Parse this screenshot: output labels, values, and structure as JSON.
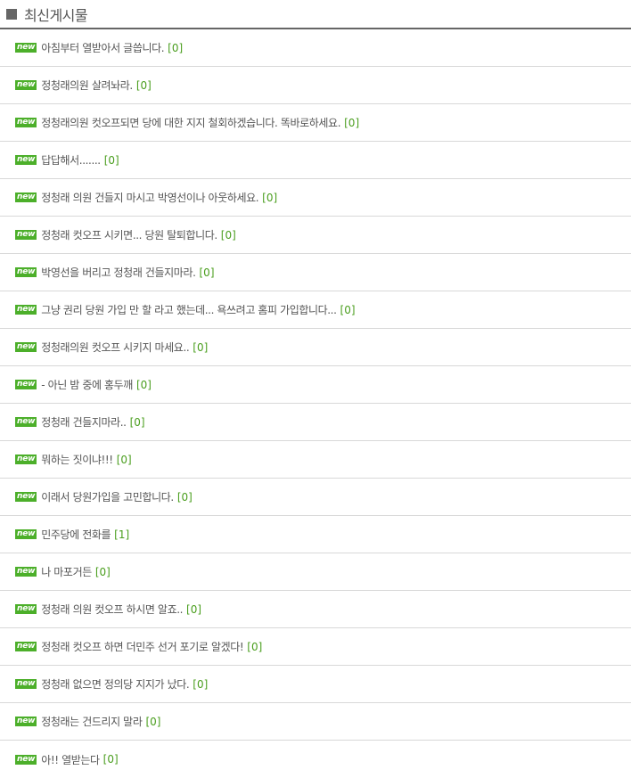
{
  "board": {
    "title": "최신게시물",
    "new_badge": "new",
    "posts": [
      {
        "title": "아침부터 열받아서 글씁니다.",
        "comments": "[0]"
      },
      {
        "title": "정청래의원 살려놔라.",
        "comments": "[0]"
      },
      {
        "title": "정청래의원 컷오프되면 당에 대한 지지 철회하겠습니다. 똑바로하세요.",
        "comments": "[0]"
      },
      {
        "title": "답답해서.......",
        "comments": "[0]"
      },
      {
        "title": "정청래 의원 건들지 마시고 박영선이나 아웃하세요.",
        "comments": "[0]"
      },
      {
        "title": "정청래 컷오프 시키면... 당원 탈퇴합니다.",
        "comments": "[0]"
      },
      {
        "title": "박영선을 버리고 정청래 건들지마라.",
        "comments": "[0]"
      },
      {
        "title": "그냥 권리 당원 가입 만 할 라고 했는데... 욕쓰려고 홈피 가입합니다...",
        "comments": "[0]"
      },
      {
        "title": "정청래의원 컷오프 시키지 마세요..",
        "comments": "[0]"
      },
      {
        "title": "- 아닌 밤 중에 홍두깨",
        "comments": "[0]"
      },
      {
        "title": "정청래 건들지마라..",
        "comments": "[0]"
      },
      {
        "title": "뭐하는 짓이냐!!!",
        "comments": "[0]"
      },
      {
        "title": "이래서 당원가입을 고민합니다.",
        "comments": "[0]"
      },
      {
        "title": "민주당에 전화를",
        "comments": "[1]"
      },
      {
        "title": "나 마포거든",
        "comments": "[0]"
      },
      {
        "title": "정청래 의원 컷오프 하시면 알죠..",
        "comments": "[0]"
      },
      {
        "title": "정청래 컷오프 하면 더민주 선거 포기로 알겠다!",
        "comments": "[0]"
      },
      {
        "title": "정청래 없으면 정의당 지지가 났다.",
        "comments": "[0]"
      },
      {
        "title": "정청래는 건드리지 말라",
        "comments": "[0]"
      },
      {
        "title": "아!! 열받는다",
        "comments": "[0]"
      }
    ]
  },
  "colors": {
    "badge_bg": "#4caf2a",
    "comment_count": "#4a9e1e",
    "header_rule": "#666666"
  }
}
